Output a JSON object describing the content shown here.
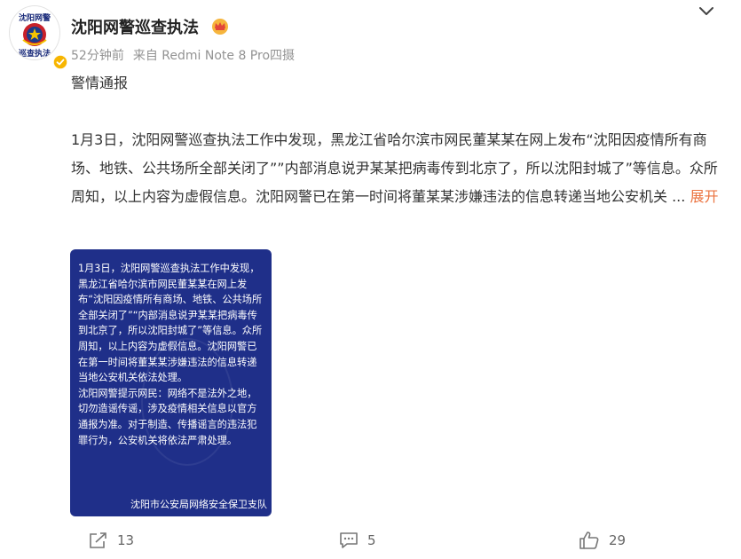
{
  "user": {
    "name": "沈阳网警巡查执法",
    "avatar_top_text": "沈阳网警",
    "avatar_bottom_text": "巡查执法"
  },
  "meta": {
    "time": "52分钟前",
    "source": "来自 Redmi Note 8 Pro四摄"
  },
  "post": {
    "headline": "警情通报",
    "body": "1月3日，沈阳网警巡查执法工作中发现，黑龙江省哈尔滨市网民董某某在网上发布“沈阳因疫情所有商场、地铁、公共场所全部关闭了””内部消息说尹某某把病毒传到北京了，所以沈阳封城了”等信息。众所周知，以上内容为虚假信息。沈阳网警已在第一时间将董某某涉嫌违法的信息转递当地公安机关 ...",
    "expand_label": "展开"
  },
  "notice_image": {
    "text": "1月3日，沈阳网警巡查执法工作中发现，黑龙江省哈尔滨市网民董某某在网上发布“沈阳因疫情所有商场、地铁、公共场所全部关闭了”“内部消息说尹某某把病毒传到北京了，所以沈阳封城了”等信息。众所周知，以上内容为虚假信息。沈阳网警已在第一时间将董某某涉嫌违法的信息转递当地公安机关依法处理。\n沈阳网警提示网民：网络不是法外之地，切勿造谣传谣，涉及疫情相关信息以官方通报为准。对于制造、传播谣言的违法犯罪行为，公安机关将依法严肃处理。",
    "footer": "沈阳市公安局网络安全保卫支队",
    "background_color": "#1f2f89"
  },
  "actions": {
    "share_count": "13",
    "comment_count": "5",
    "like_count": "29"
  },
  "colors": {
    "accent": "#eb7340",
    "meta_text": "#939393"
  },
  "icons": [
    "police-emblem-icon",
    "verified-icon",
    "crown-icon",
    "chevron-down-icon",
    "share-icon",
    "comment-icon",
    "like-icon"
  ]
}
